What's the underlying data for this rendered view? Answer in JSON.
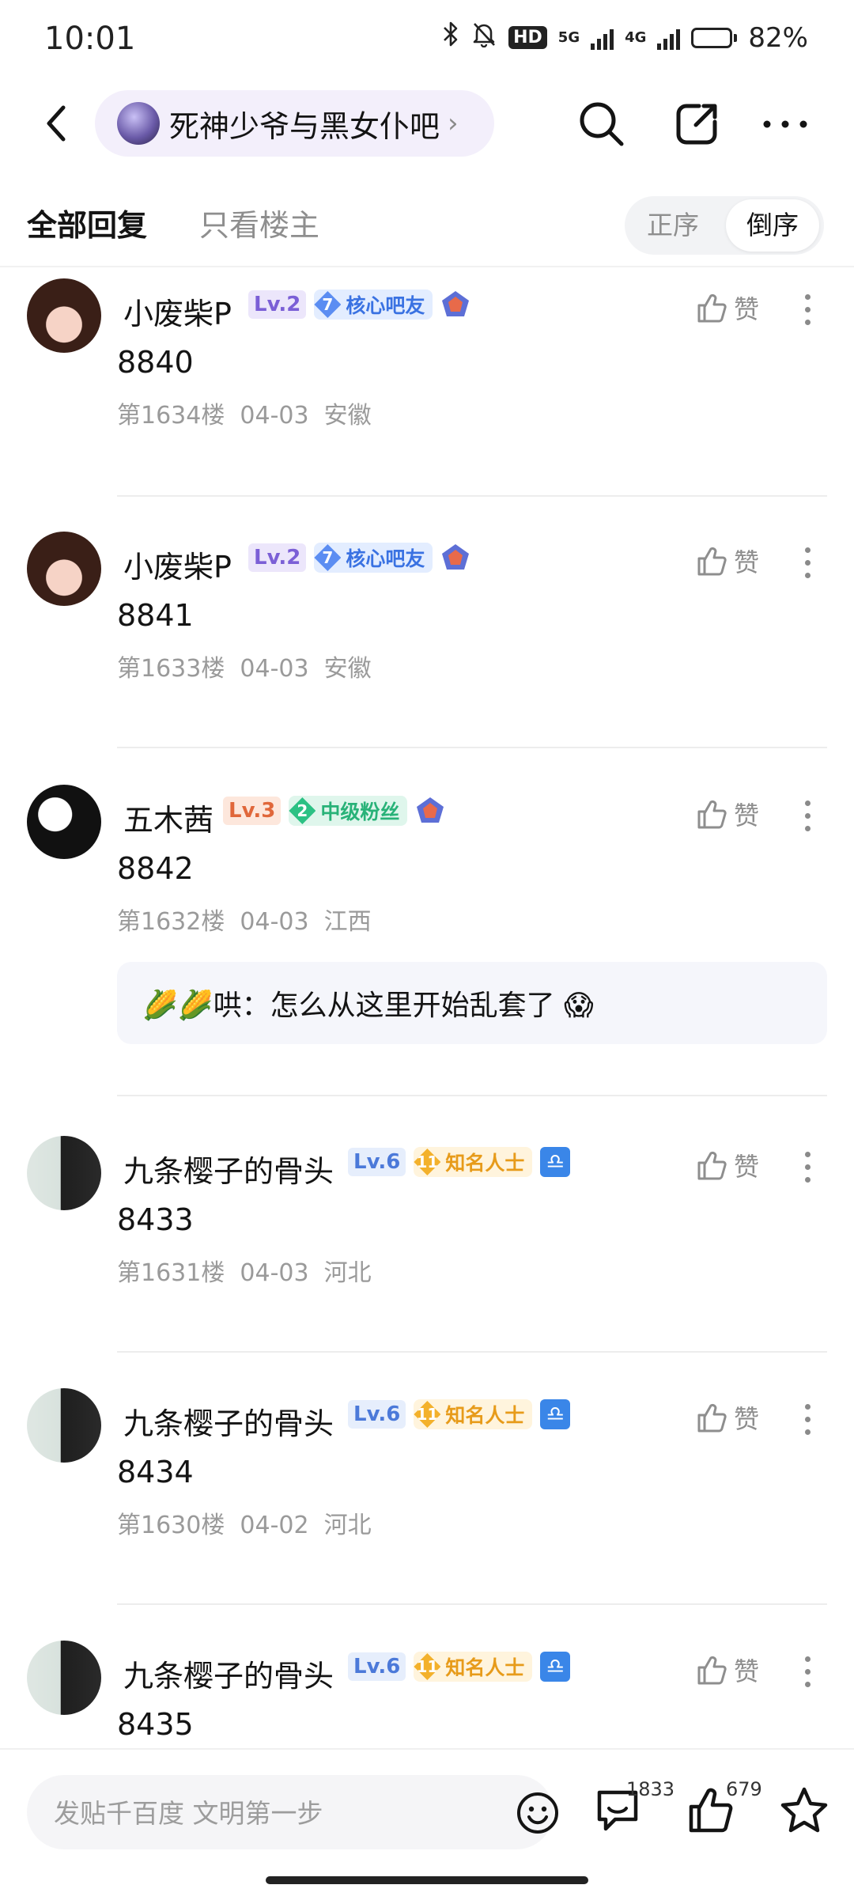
{
  "status_bar": {
    "time": "10:01",
    "hd_label": "HD",
    "net_5g": "5G",
    "net_4g": "4G",
    "battery_percent": 82,
    "battery_label": "82%"
  },
  "header": {
    "forum_name": "死神少爷与黑女仆吧"
  },
  "tabs": {
    "all_replies": "全部回复",
    "op_only": "只看楼主",
    "order_asc": "正序",
    "order_desc": "倒序"
  },
  "like_label": "赞",
  "posts": [
    {
      "username": "小废柴P",
      "level": "Lv.2",
      "tag_num": "7",
      "tag_label": "核心吧友",
      "content": "8840",
      "meta": "第1634楼  04-03  安徽"
    },
    {
      "username": "小废柴P",
      "level": "Lv.2",
      "tag_num": "7",
      "tag_label": "核心吧友",
      "content": "8841",
      "meta": "第1633楼  04-03  安徽"
    },
    {
      "username": "五木茜",
      "level": "Lv.3",
      "tag_num": "2",
      "tag_label": "中级粉丝",
      "content": "8842",
      "meta": "第1632楼  04-03  江西",
      "reply": "🌽🌽哄：怎么从这里开始乱套了 😱"
    },
    {
      "username": "九条樱子的骨头",
      "level": "Lv.6",
      "tag_num": "11",
      "tag_label": "知名人士",
      "content": "8433",
      "meta": "第1631楼  04-03  河北"
    },
    {
      "username": "九条樱子的骨头",
      "level": "Lv.6",
      "tag_num": "11",
      "tag_label": "知名人士",
      "content": "8434",
      "meta": "第1630楼  04-02  河北"
    },
    {
      "username": "九条樱子的骨头",
      "level": "Lv.6",
      "tag_num": "11",
      "tag_label": "知名人士",
      "content": "8435"
    }
  ],
  "bottom_bar": {
    "input_placeholder": "发贴千百度 文明第一步",
    "comment_count": "1833",
    "like_count": "679"
  }
}
